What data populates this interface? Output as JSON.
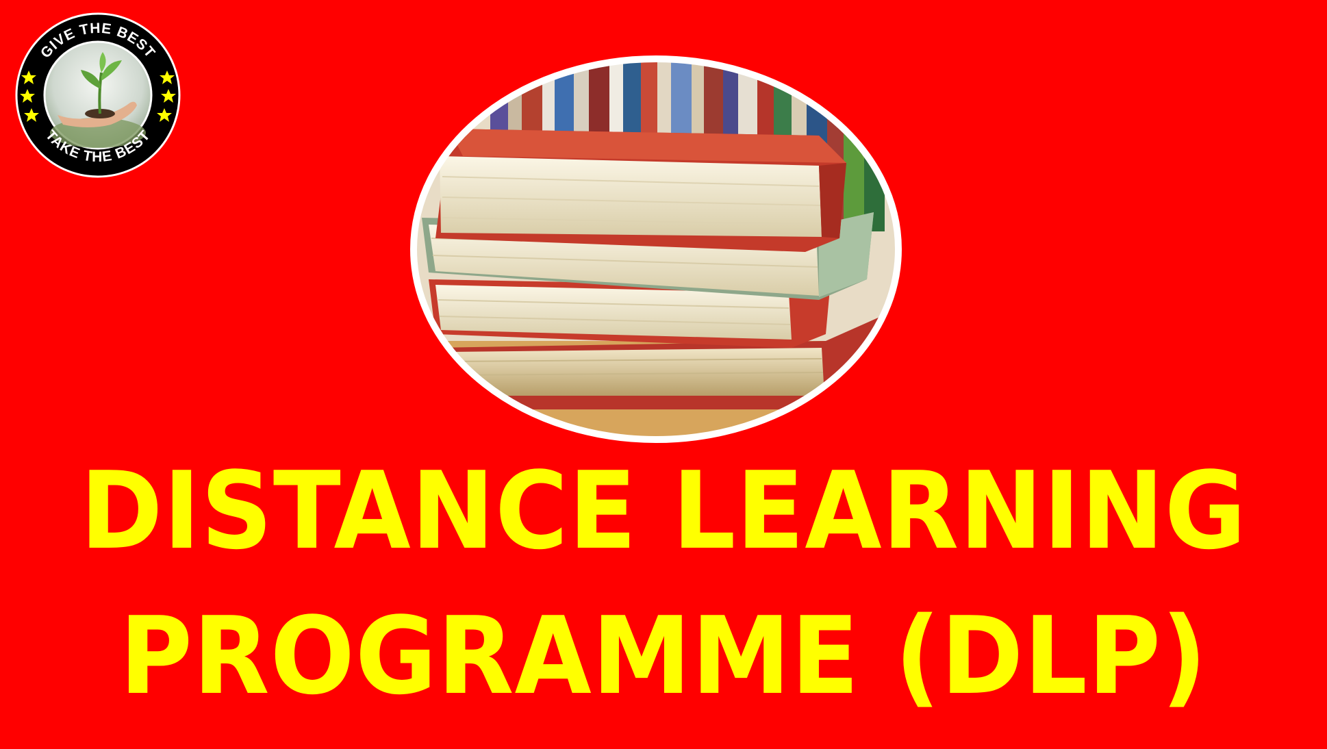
{
  "banner": {
    "background_color": "#ff0000",
    "text_color": "#ffff00",
    "headline_line_1": "DISTANCE LEARNING",
    "headline_line_2": "PROGRAMME (DLP)"
  },
  "logo": {
    "top_text": "GIVE THE BEST",
    "bottom_text": "TAKE THE BEST",
    "icon": "seedling-in-hand-icon",
    "ring_color": "#000000",
    "star_color": "#ffff00"
  },
  "illustration": {
    "icon": "stack-of-books-icon"
  }
}
